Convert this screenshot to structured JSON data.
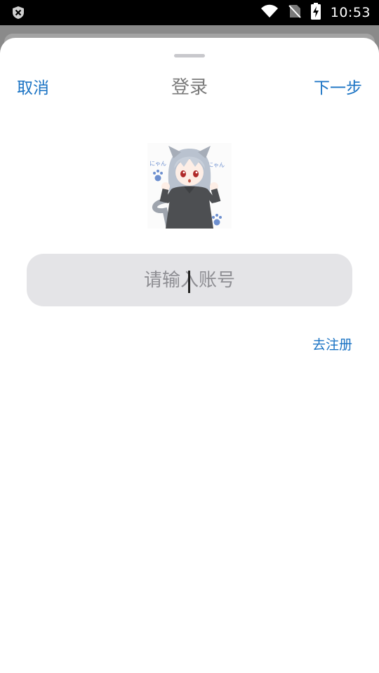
{
  "status_bar": {
    "time": "10:53",
    "left_icon": "shield-x-icon",
    "icons": [
      "wifi-icon",
      "no-sim-icon",
      "battery-charging-icon"
    ]
  },
  "header": {
    "cancel_label": "取消",
    "title": "登录",
    "next_label": "下一步"
  },
  "avatar": {
    "icon": "anime-cat-girl-avatar",
    "captions": [
      "にゃん",
      "にゃん"
    ]
  },
  "form": {
    "account_placeholder": "请输入账号",
    "account_value": ""
  },
  "register_label": "去注册",
  "colors": {
    "accent": "#1a73c4",
    "title": "#7a7a7a",
    "input_bg": "#e4e4e7",
    "placeholder": "#8e8e93"
  }
}
